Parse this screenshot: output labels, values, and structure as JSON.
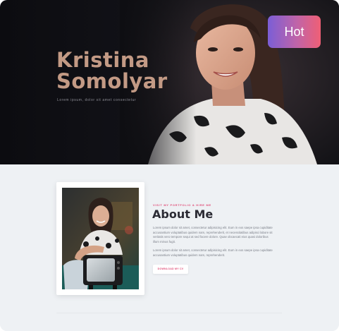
{
  "hero": {
    "name_line_1": "Kristina",
    "name_line_2": "Somolyar",
    "subtitle": "Lorem ipsum, dolor sit amet consectetur"
  },
  "badge": {
    "label": "Hot"
  },
  "about": {
    "eyebrow": "VISIT MY PORTFOLIO & HIRE ME",
    "title": "About Me",
    "paragraph_1": "Lorem ipsum dolor sit amet, consectetur adipisicing elit. Eum in eos saepe ipsa cupiditate accusantium voluptatibus quidem nam, reprehenderit, et necessitatibus adipisci labore sit veritatis vero tempore sequi at sed facere dolore. Quae obcaecati eius quasi doloribus illum minus fugit.",
    "paragraph_2": "Lorem ipsum dolor sit amet, consectetur adipisicing elit. Eum in eos saepe ipsa cupiditate accusantium voluptatibus quidem nam, reprehenderit.",
    "cv_button_label": "DOWNLOAD MY CV"
  },
  "colors": {
    "accent": "#e0507a",
    "name_color": "#c39a85",
    "hero_bg": "#0c0c10",
    "badge_start": "#7b5ed6",
    "badge_end": "#ef5f75"
  },
  "icons": [
    "hero-portrait-image",
    "about-portrait-image"
  ]
}
